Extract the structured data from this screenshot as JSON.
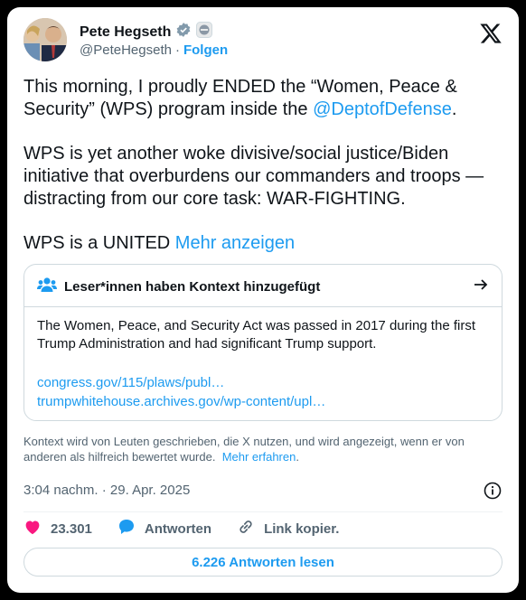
{
  "author": {
    "name": "Pete Hegseth",
    "handle": "@PeteHegseth",
    "dot": "·",
    "follow_label": "Folgen"
  },
  "tweet": {
    "p1_a": "This morning, I proudly ENDED the “Women, Peace & Security” (WPS) program inside the ",
    "p1_mention": "@DeptofDefense",
    "p1_end": ".",
    "p2": "WPS is yet another woke divisive/social justice/Biden initiative that overburdens our commanders and troops — distracting from our core task: WAR-FIGHTING.",
    "p3": "WPS is a UNITED ",
    "show_more": "Mehr anzeigen"
  },
  "context": {
    "title": "Leser*innen haben Kontext hinzugefügt",
    "body": "The Women, Peace, and Security Act was passed in 2017 during the first Trump Administration and had significant Trump support.",
    "link1": "congress.gov/115/plaws/publ…",
    "link2": "trumpwhitehouse.archives.gov/wp-content/upl…",
    "note": "Kontext wird von Leuten geschrieben, die X nutzen, und wird angezeigt, wenn er von anderen als hilfreich bewertet wurde.",
    "note_more": "Mehr erfahren",
    "note_end": "."
  },
  "timestamp": "3:04 nachm. · 29. Apr. 2025",
  "actions": {
    "likes": "23.301",
    "reply_label": "Antworten",
    "copy_label": "Link kopier."
  },
  "read_replies": "6.226 Antworten lesen",
  "colors": {
    "accent": "#1d9bf0",
    "like": "#f91880",
    "muted": "#536471"
  },
  "icons": [
    "verified-badge-icon",
    "affiliate-badge-icon",
    "x-logo-icon",
    "people-icon",
    "arrow-right-icon",
    "info-icon",
    "heart-icon",
    "reply-bubble-icon",
    "link-icon"
  ]
}
